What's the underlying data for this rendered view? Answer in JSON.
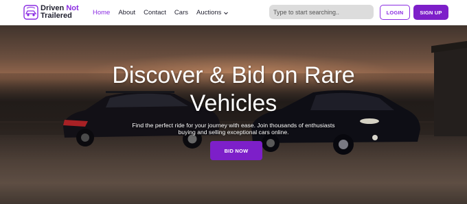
{
  "brand": {
    "name_line1": "Driven",
    "name_accent": "Not",
    "name_line2": "Trailered",
    "accent_color": "#8a2be2",
    "logo_icon": "car-logo-icon"
  },
  "nav": {
    "items": [
      {
        "label": "Home",
        "active": true
      },
      {
        "label": "About",
        "active": false
      },
      {
        "label": "Contact",
        "active": false
      },
      {
        "label": "Cars",
        "active": false
      },
      {
        "label": "Auctions",
        "active": false,
        "dropdown": true
      }
    ]
  },
  "search": {
    "placeholder": "Type to start searching..",
    "value": ""
  },
  "auth": {
    "login_label": "LOGIN",
    "signup_label": "SIGN UP"
  },
  "hero": {
    "title": "Discover & Bid on Rare Vehicles",
    "subtitle": "Find the perfect ride for your journey with ease. Join thousands of enthusiasts buying and selling exceptional cars online.",
    "cta_label": "BID NOW"
  }
}
